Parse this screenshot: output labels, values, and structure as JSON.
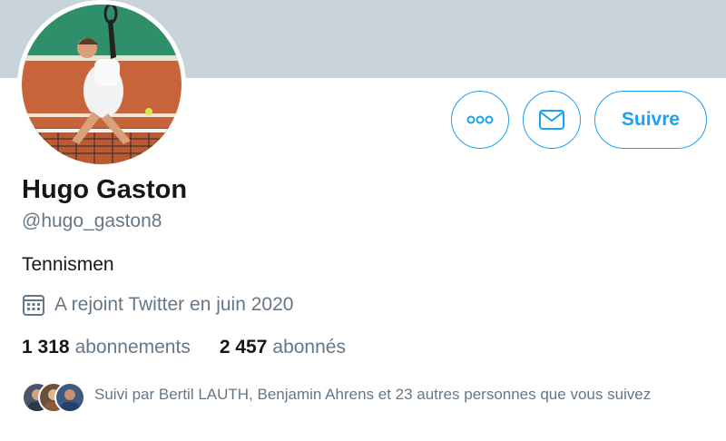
{
  "profile": {
    "name": "Hugo Gaston",
    "handle": "@hugo_gaston8",
    "bio": "Tennismen",
    "joined": "A rejoint Twitter en juin 2020",
    "following_count": "1 318",
    "following_label": "abonnements",
    "followers_count": "2 457",
    "followers_label": "abonnés",
    "followed_by": "Suivi par Bertil LAUTH, Benjamin Ahrens et 23 autres personnes que vous suivez"
  },
  "actions": {
    "more_icon": "more-horizontal-icon",
    "message_icon": "envelope-icon",
    "follow_label": "Suivre"
  },
  "icons": {
    "joined": "calendar-icon"
  },
  "colors": {
    "accent": "#1da1f2",
    "banner": "#c9d3dc",
    "secondary_text": "#657786",
    "primary_text": "#14171a"
  }
}
